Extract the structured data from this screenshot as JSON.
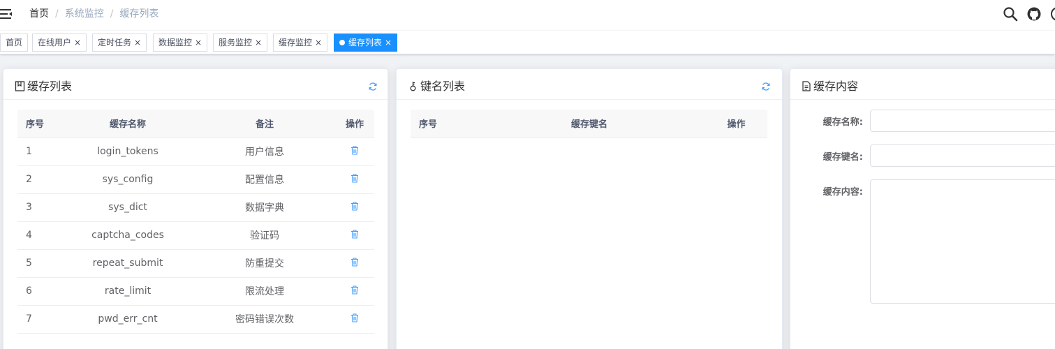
{
  "navbar": {
    "breadcrumb": [
      "首页",
      "系统监控",
      "缓存列表"
    ],
    "icons": [
      "search-icon",
      "github-icon",
      "question-icon"
    ]
  },
  "tags": [
    {
      "label": "首页",
      "closable": false,
      "active": false
    },
    {
      "label": "在线用户",
      "closable": true,
      "active": false
    },
    {
      "label": "定时任务",
      "closable": true,
      "active": false
    },
    {
      "label": "数据监控",
      "closable": true,
      "active": false
    },
    {
      "label": "服务监控",
      "closable": true,
      "active": false
    },
    {
      "label": "缓存监控",
      "closable": true,
      "active": false
    },
    {
      "label": "缓存列表",
      "closable": true,
      "active": true
    }
  ],
  "close_glyph": "×",
  "cache_list": {
    "title": "缓存列表",
    "columns": [
      "序号",
      "缓存名称",
      "备注",
      "操作"
    ],
    "rows": [
      {
        "index": "1",
        "name": "login_tokens",
        "remark": "用户信息"
      },
      {
        "index": "2",
        "name": "sys_config",
        "remark": "配置信息"
      },
      {
        "index": "3",
        "name": "sys_dict",
        "remark": "数据字典"
      },
      {
        "index": "4",
        "name": "captcha_codes",
        "remark": "验证码"
      },
      {
        "index": "5",
        "name": "repeat_submit",
        "remark": "防重提交"
      },
      {
        "index": "6",
        "name": "rate_limit",
        "remark": "限流处理"
      },
      {
        "index": "7",
        "name": "pwd_err_cnt",
        "remark": "密码错误次数"
      }
    ]
  },
  "key_list": {
    "title": "键名列表",
    "columns": [
      "序号",
      "缓存键名",
      "操作"
    ]
  },
  "cache_content": {
    "title": "缓存内容",
    "fields": [
      {
        "label": "缓存名称:",
        "value": ""
      },
      {
        "label": "缓存键名:",
        "value": ""
      },
      {
        "label": "缓存内容:",
        "value": ""
      }
    ]
  },
  "colors": {
    "accent": "#1890ff",
    "icon_blue": "#409eff"
  }
}
